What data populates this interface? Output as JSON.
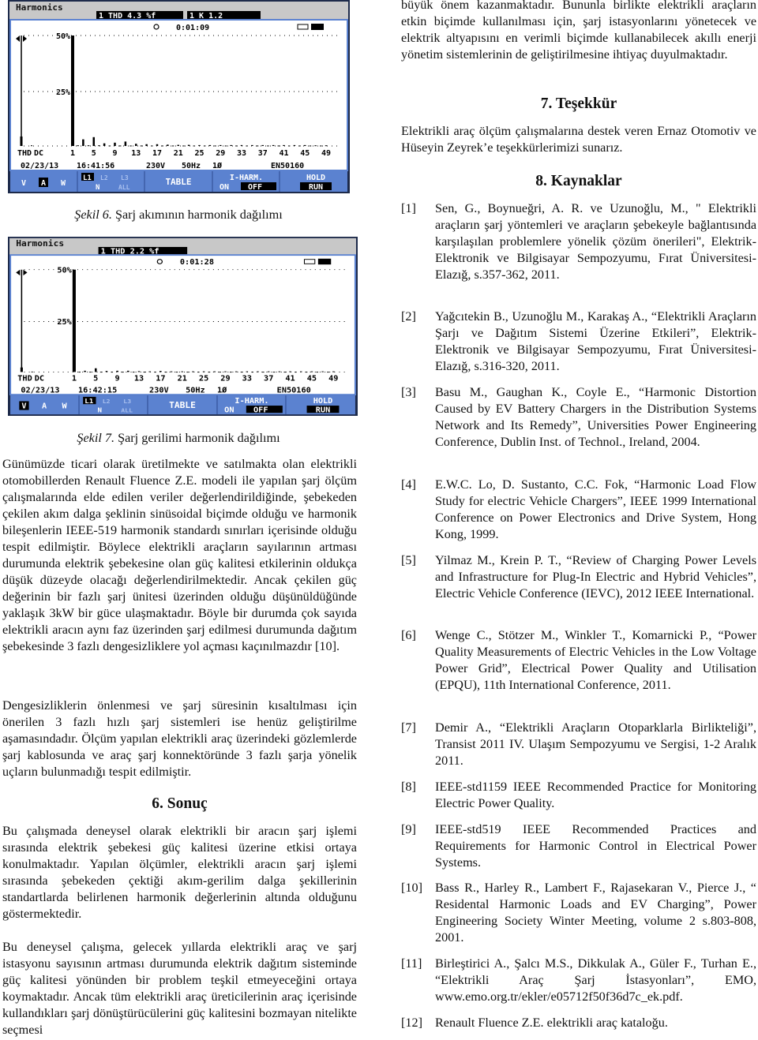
{
  "figures": [
    {
      "caption_label": "Şekil 6.",
      "caption_text": " Şarj akımının harmonik dağılımı",
      "screen": {
        "title": "Harmonics",
        "badge1": "1 THD   4.3 %f",
        "badge2": "1 K      1.2",
        "timer": "0:01:09",
        "grid_50": "50%",
        "grid_25": "25%",
        "axis_thd": "THD",
        "axis_dc": "DC",
        "date": "02/23/13",
        "time": "16:41:56",
        "voltage": "230V",
        "freq": "50Hz",
        "phase": "1Ø",
        "standard": "EN50160",
        "keys": {
          "v": "V",
          "a": "A",
          "w": "W",
          "l1": "L1",
          "l2": "L2",
          "l3": "L3",
          "n": "N",
          "all": "ALL",
          "table": "TABLE",
          "iharm": "I-HARM.",
          "on": "ON",
          "off": "OFF",
          "hold": "HOLD",
          "run": "RUN"
        },
        "selected_unit": "A"
      }
    },
    {
      "caption_label": "Şekil 7.",
      "caption_text": " Şarj gerilimi harmonik dağılımı",
      "screen": {
        "title": "Harmonics",
        "badge1": "1 THD   2.2 %f",
        "timer": "0:01:28",
        "grid_50": "50%",
        "grid_25": "25%",
        "axis_thd": "THD",
        "axis_dc": "DC",
        "date": "02/23/13",
        "time": "16:42:15",
        "voltage": "230V",
        "freq": "50Hz",
        "phase": "1Ø",
        "standard": "EN50160",
        "keys": {
          "v": "V",
          "a": "A",
          "w": "W",
          "l1": "L1",
          "l2": "L2",
          "l3": "L3",
          "n": "N",
          "all": "ALL",
          "table": "TABLE",
          "iharm": "I-HARM.",
          "on": "ON",
          "off": "OFF",
          "hold": "HOLD",
          "run": "RUN"
        },
        "selected_unit": "V"
      }
    }
  ],
  "chart_data": [
    {
      "type": "bar",
      "title": "Harmonics",
      "ylim": [
        0,
        50
      ],
      "yticks": [
        "25%",
        "50%"
      ],
      "xtick_labels": [
        "THD",
        "DC",
        "1",
        "5",
        "9",
        "13",
        "17",
        "21",
        "25",
        "29",
        "33",
        "37",
        "41",
        "45",
        "49"
      ],
      "thd": 4.3,
      "dc": 0.3,
      "harmonics": [
        50,
        0.3,
        3,
        0.3,
        4,
        0.3,
        1.2,
        0.2,
        1.5,
        0.2,
        2,
        0.2,
        1,
        0.2,
        0.8,
        0.2,
        0.8,
        0.2,
        0.6,
        0.2,
        0.5,
        0.2,
        0.5,
        0.2,
        0.4,
        0.2,
        0.4,
        0.2,
        0.4,
        0.2,
        0.4,
        0.2,
        0.4,
        0.2,
        0.4,
        0.2,
        0.4,
        0.2,
        0.4,
        0.2,
        0.4,
        0.2,
        0.4,
        0.2,
        0.4,
        0.2,
        0.3,
        0.2,
        0.3
      ]
    },
    {
      "type": "bar",
      "title": "Harmonics",
      "ylim": [
        0,
        50
      ],
      "yticks": [
        "25%",
        "50%"
      ],
      "xtick_labels": [
        "THD",
        "DC",
        "1",
        "5",
        "9",
        "13",
        "17",
        "21",
        "25",
        "29",
        "33",
        "37",
        "41",
        "45",
        "49"
      ],
      "thd": 2.2,
      "dc": 0.2,
      "harmonics": [
        50,
        0.1,
        0.6,
        0.1,
        1.8,
        0.1,
        0.5,
        0.1,
        0.6,
        0.1,
        0.6,
        0.1,
        0.4,
        0.1,
        0.3,
        0.1,
        0.5,
        0.1,
        0.3,
        0.1,
        0.3,
        0.1,
        0.3,
        0.1,
        0.3,
        0.1,
        0.3,
        0.1,
        0.3,
        0.1,
        0.3,
        0.1,
        0.3,
        0.1,
        0.3,
        0.1,
        0.3,
        0.1,
        0.3,
        0.1,
        0.3,
        0.1,
        0.3,
        0.1,
        0.3,
        0.1,
        0.3,
        0.1,
        0.3
      ]
    }
  ],
  "left": {
    "p1": "Günümüzde ticari olarak üretilmekte ve satılmakta olan elektrikli otomobillerden Renault Fluence Z.E. modeli ile yapılan şarj ölçüm çalışmalarında elde edilen veriler değerlendirildiğinde, şebekeden çekilen akım dalga şeklinin sinüsoidal biçimde olduğu ve harmonik bileşenlerin IEEE-519 harmonik standardı sınırları içerisinde olduğu tespit edilmiştir. Böylece elektrikli araçların sayılarının artması durumunda elektrik şebekesine olan güç kalitesi etkilerinin oldukça düşük düzeyde olacağı değerlendirilmektedir. Ancak çekilen güç değerinin bir fazlı şarj ünitesi üzerinden olduğu düşünüldüğünde yaklaşık 3kW bir güce ulaşmaktadır. Böyle bir durumda çok sayıda elektrikli aracın aynı faz üzerinden şarj edilmesi durumunda dağıtım şebekesinde 3 fazlı dengesizliklere yol açması kaçınılmazdır [10].",
    "p2": "Dengesizliklerin önlenmesi ve şarj süresinin kısaltılması için önerilen 3 fazlı hızlı şarj sistemleri ise henüz geliştirilme aşamasındadır. Ölçüm yapılan elektrikli araç üzerindeki gözlemlerde şarj kablosunda ve araç şarj konnektöründe 3 fazlı şarja yönelik uçların bulunmadığı tespit edilmiştir.",
    "heading6": "6.  Sonuç",
    "p3": "Bu çalışmada deneysel olarak elektrikli bir aracın şarj işlemi sırasında elektrik şebekesi güç kalitesi üzerine etkisi ortaya konulmaktadır. Yapılan ölçümler, elektrikli aracın şarj işlemi sırasında şebekeden çektiği akım-gerilim dalga şekillerinin standartlarda belirlenen harmonik değerlerinin altında olduğunu göstermektedir.",
    "p4": "Bu deneysel çalışma, gelecek yıllarda elektrikli araç ve şarj istasyonu sayısının artması durumunda elektrik dağıtım sisteminde güç kalitesi yönünden bir problem teşkil etmeyeceğini ortaya koymaktadır. Ancak tüm elektrikli araç üreticilerinin araç içerisinde kullandıkları şarj dönüştürücülerini güç kalitesini bozmayan nitelikte seçmesi"
  },
  "right": {
    "p0": "büyük önem kazanmaktadır. Bununla birlikte elektrikli araçların etkin biçimde kullanılması için, şarj istasyonlarını yönetecek ve elektrik altyapısını en verimli biçimde kullanabilecek akıllı enerji yönetim sistemlerinin de geliştirilmesine ihtiyaç duyulmaktadır.",
    "heading7": "7.  Teşekkür",
    "p1": "Elektrikli araç ölçüm çalışmalarına destek veren Ernaz Otomotiv ve Hüseyin Zeyrek’e teşekkürlerimizi sunarız.",
    "heading8": "8.  Kaynaklar",
    "refs": [
      {
        "num": "[1]",
        "text": "Sen, G., Boynueğri, A. R. ve Uzunoğlu, M., \" Elektrikli araçların şarj yöntemleri ve araçların şebekeyle bağlantısında karşılaşılan problemlere yönelik çözüm önerileri\", Elektrik-Elektronik ve Bilgisayar Sempozyumu, Fırat Üniversitesi-Elazığ, s.357-362, 2011."
      },
      {
        "num": "[2]",
        "text": "Yağcıtekin B., Uzunoğlu M., Karakaş A., “Elektrikli Araçların Şarjı ve Dağıtım Sistemi Üzerine Etkileri”, Elektrik-Elektronik ve Bilgisayar Sempozyumu, Fırat Üniversitesi-Elazığ, s.316-320, 2011."
      },
      {
        "num": "[3]",
        "text": "Basu M., Gaughan K., Coyle E., “Harmonic Distortion Caused by EV Battery Chargers in the Distribution Systems Network and Its Remedy”, Universities Power Engineering Conference, Dublin Inst. of Technol., Ireland, 2004."
      },
      {
        "num": "[4]",
        "text": "E.W.C. Lo, D. Sustanto, C.C. Fok, “Harmonic Load Flow Study for electric Vehicle Chargers”, IEEE 1999 International Conference on Power Electronics and Drive System, Hong Kong, 1999."
      },
      {
        "num": "[5]",
        "text": "Yilmaz M., Krein P. T., “Review of Charging Power Levels and Infrastructure for Plug-In Electric and Hybrid Vehicles”, Electric Vehicle Conference (IEVC), 2012 IEEE International."
      },
      {
        "num": "[6]",
        "text": "Wenge C., Stötzer M., Winkler T., Komarnicki P., “Power Quality Measurements of Electric Vehicles in the Low Voltage Power Grid”, Electrical Power Quality and Utilisation (EPQU), 11th International Conference, 2011."
      },
      {
        "num": "[7]",
        "text": "Demir A., “Elektrikli Araçların Otoparklarla Birlikteliği”, Transist 2011 IV. Ulaşım Sempozyumu ve Sergisi, 1-2 Aralık 2011."
      },
      {
        "num": "[8]",
        "text": "IEEE-std1159 IEEE Recommended Practice for Monitoring Electric Power Quality."
      },
      {
        "num": "[9]",
        "text": "IEEE-std519 IEEE Recommended Practices and Requirements for Harmonic Control in Electrical Power Systems."
      },
      {
        "num": "[10]",
        "text": "Bass R., Harley R., Lambert F., Rajasekaran V., Pierce J., “ Residental Harmonic Loads and EV Charging”, Power Engineering Society Winter Meeting, volume 2 s.803-808, 2001."
      },
      {
        "num": "[11]",
        "text": "Birleştirici A., Şalcı M.S., Dikkulak A., Güler F., Turhan E., “Elektrikli Araç Şarj İstasyonları”, EMO, www.emo.org.tr/ekler/e05712f50f36d7c_ek.pdf."
      },
      {
        "num": "[12]",
        "text": "Renault Fluence Z.E. elektrikli araç kataloğu."
      }
    ]
  },
  "colors": {
    "screen_blue": "#5b82d0",
    "screen_header": "#c8c8c8",
    "frame": "#1d2a4a"
  }
}
